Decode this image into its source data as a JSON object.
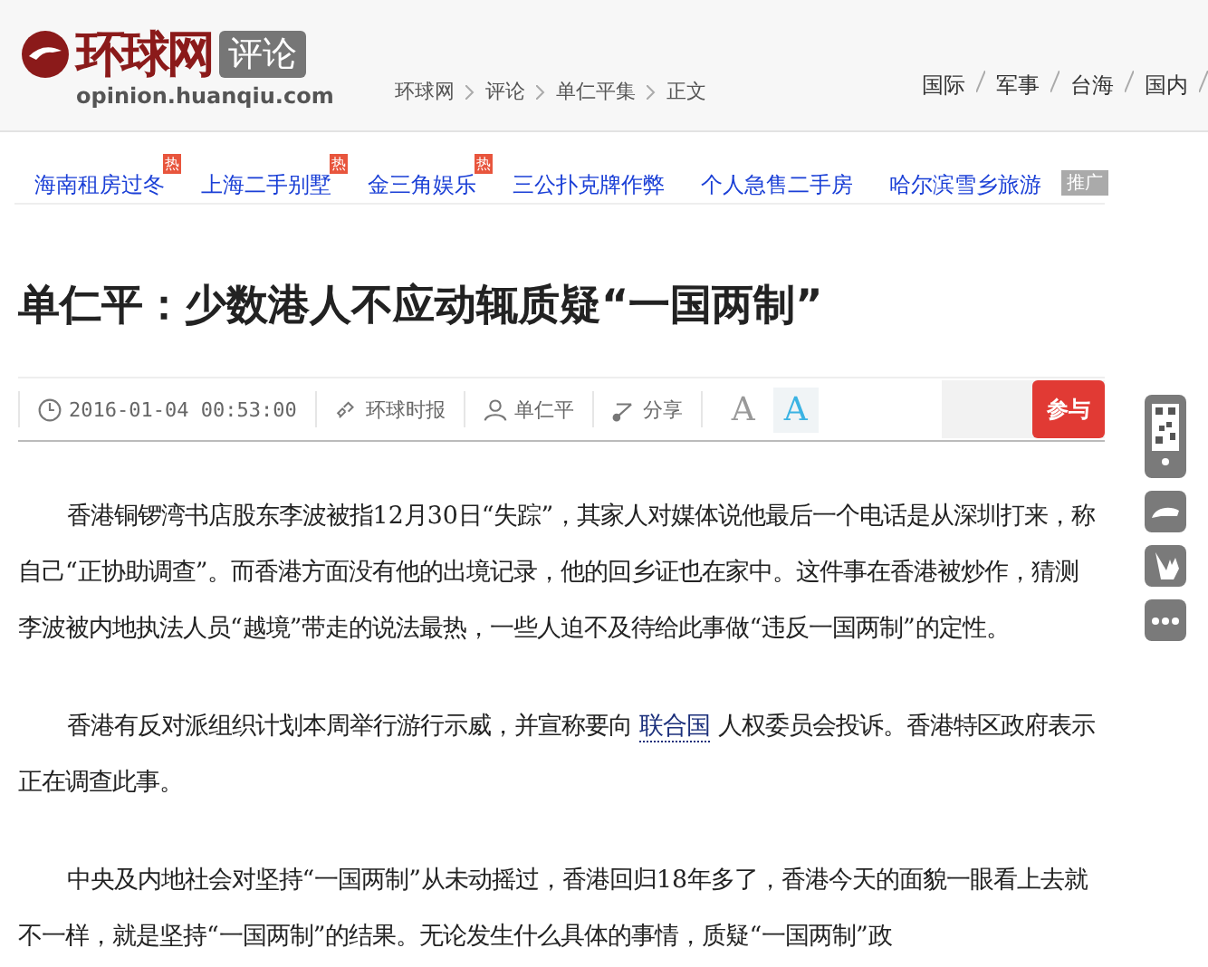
{
  "header": {
    "logo_text": "环球网",
    "section_badge": "评论",
    "domain": "opinion.huanqiu.com",
    "breadcrumb": [
      "环球网",
      "评论",
      "单仁平集",
      "正文"
    ],
    "nav": [
      "国际",
      "军事",
      "台海",
      "国内"
    ]
  },
  "promo_links": [
    {
      "text": "海南租房过冬",
      "hot_badge": "热"
    },
    {
      "text": "上海二手别墅",
      "hot_badge": "热"
    },
    {
      "text": "金三角娱乐",
      "hot_badge": "热"
    },
    {
      "text": "三公扑克牌作弊"
    },
    {
      "text": "个人急售二手房"
    },
    {
      "text": "哈尔滨雪乡旅游"
    }
  ],
  "ad_label": "推广",
  "article": {
    "title": "单仁平：少数港人不应动辄质疑“一国两制”",
    "toolbar": {
      "datetime": "2016-01-04 00:53:00",
      "source": "环球时报",
      "author": "单仁平",
      "share": "分享",
      "font_smaller": "A",
      "font_larger": "A",
      "join": "参与"
    },
    "paragraphs": [
      {
        "before": "香港铜锣湾书店股东李波被指12月30日“失踪”，其家人对媒体说他最后一个电话是从深圳打来，称自己“正协助调查”。而香港方面没有他的出境记录，他的回乡证也在家中。这件事在香港被炒作，猜测李波被内地执法人员“越境”带走的说法最热，一些人迫不及待给此事做“违反一国两制”的定性。"
      },
      {
        "before": "香港有反对派组织计划本周举行游行示威，并宣称要向 ",
        "link": "联合国",
        "after": " 人权委员会投诉。香港特区政府表示正在调查此事。"
      },
      {
        "before": "中央及内地社会对坚持“一国两制”从未动摇过，香港回归18年多了，香港今天的面貌一眼看上去就不一样，就是坚持“一国两制”的结果。无论发生什么具体的事情，质疑“一国两制”政"
      }
    ]
  }
}
